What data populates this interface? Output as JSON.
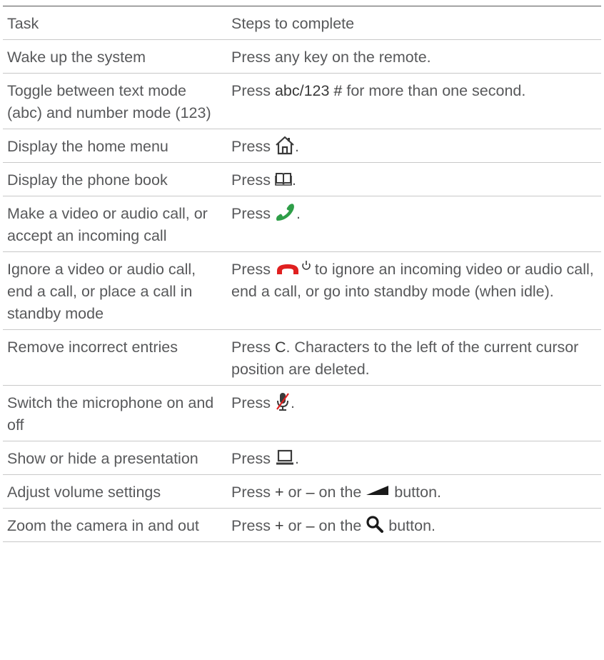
{
  "header": {
    "task": "Task",
    "steps": "Steps to complete"
  },
  "rows": [
    {
      "task": "Wake up the system",
      "steps": "Press any key on the remote."
    },
    {
      "task": "Toggle between text mode (abc) and number mode (123)",
      "steps_pre": "Press ",
      "key": "abc/123 #",
      "steps_post": " for more than one second."
    },
    {
      "task": "Display the home menu",
      "steps_pre": "Press ",
      "icon": "home-icon",
      "steps_post": "."
    },
    {
      "task": "Display the phone book",
      "steps_pre": "Press ",
      "icon": "phonebook-icon",
      "steps_post": "."
    },
    {
      "task": "Make a video or audio call, or accept an incoming call",
      "steps_pre": "Press ",
      "icon": "call-icon",
      "steps_post": "."
    },
    {
      "task": "Ignore a video or audio call, end a call, or place a call in standby mode",
      "steps_pre": "Press ",
      "icon": "end-call-power-icon",
      "steps_post": " to ignore an incoming video or audio call, end a call, or go into standby mode (when idle)."
    },
    {
      "task": "Remove incorrect entries",
      "steps_pre": "Press ",
      "key": "C",
      "steps_post": ". Characters to the left of the current cursor position are deleted."
    },
    {
      "task": "Switch the microphone on and off",
      "steps_pre": "Press ",
      "icon": "mic-mute-icon",
      "steps_post": "."
    },
    {
      "task": "Show or hide a presentation",
      "steps_pre": "Press ",
      "icon": "presentation-icon",
      "steps_post": "."
    },
    {
      "task": "Adjust volume settings",
      "steps_pre": "Press ",
      "key_plus": "+",
      "or": " or ",
      "key_minus": "–",
      "steps_mid": " on the ",
      "icon": "volume-icon",
      "steps_post": " button."
    },
    {
      "task": "Zoom the camera in and out",
      "steps_pre": "Press ",
      "key_plus": "+",
      "or": " or ",
      "key_minus": "–",
      "steps_mid": " on the ",
      "icon": "zoom-icon",
      "steps_post": " button."
    }
  ],
  "colors": {
    "text": "#58595b",
    "call_green": "#2e9e48",
    "end_red": "#e02020",
    "rule": "#c8c8c8"
  }
}
